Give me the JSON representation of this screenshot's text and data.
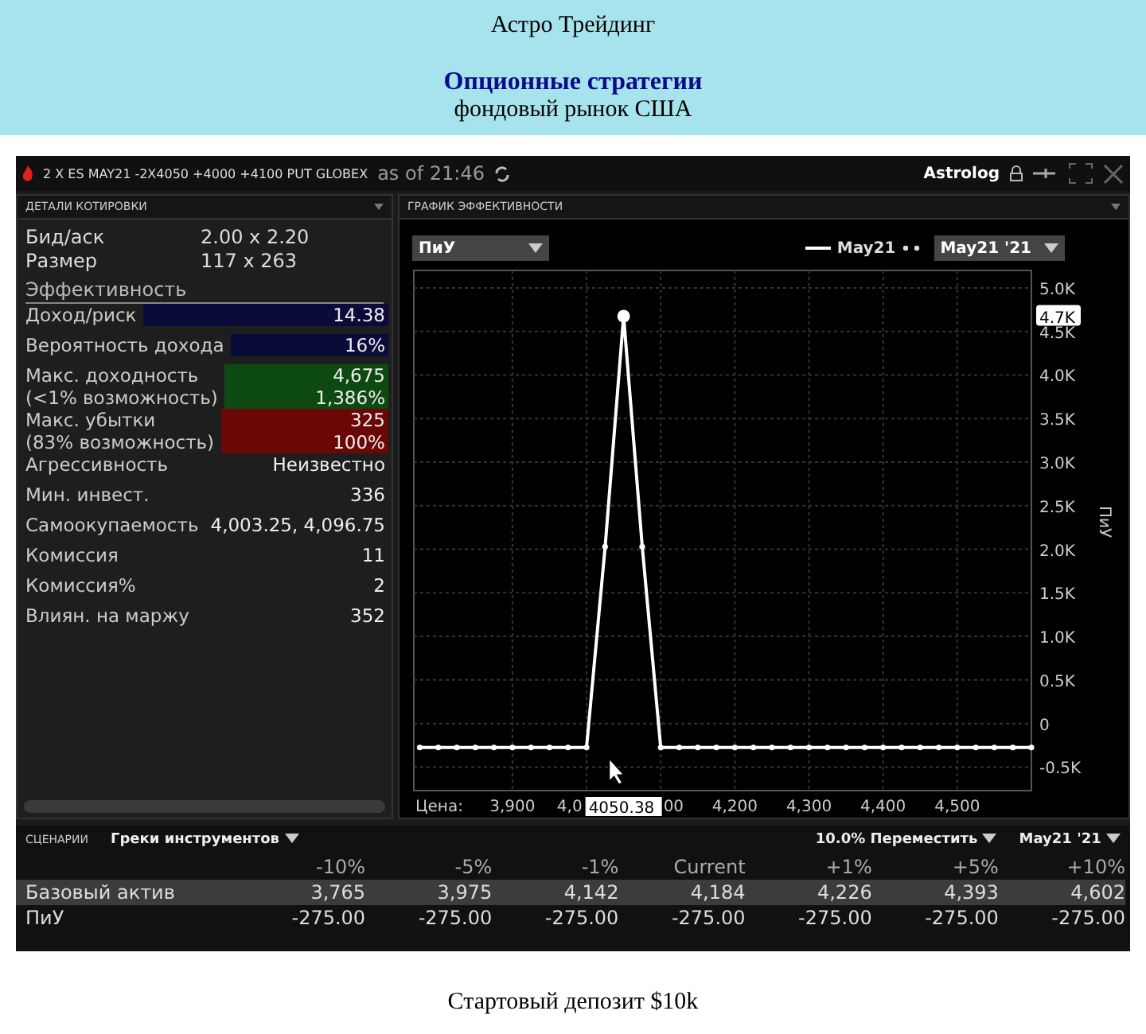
{
  "header": {
    "title": "Астро Трейдинг",
    "subtitle": "Опционные стратегии",
    "caption": "фондовый рынок США"
  },
  "app": {
    "instrument": "2 X ES MAY21  -2X4050  +4000  +4100 PUT GLOBEX",
    "as_of": "as of 21:46",
    "account": "Astrolog"
  },
  "quote_panel": {
    "title": "ДЕТАЛИ КОТИРОВКИ",
    "rows": [
      {
        "label": "Бид/аск",
        "value": "2.00 x 2.20"
      },
      {
        "label": "Размер",
        "value": "117 x 263"
      }
    ],
    "section": "Эффективность",
    "metrics": [
      {
        "labels": [
          "Доход/риск"
        ],
        "values": [
          "14.38"
        ],
        "color": "#0b0b3a"
      },
      {
        "labels": [
          "Вероятность дохода"
        ],
        "values": [
          "16%"
        ],
        "color": "#0b0b3a"
      },
      {
        "labels": [
          "Макс. доходность",
          "(<1% возможность)"
        ],
        "values": [
          "4,675",
          "1,386%"
        ],
        "color": "#0d4a12"
      },
      {
        "labels": [
          "Макс. убытки",
          "(83% возможность)"
        ],
        "values": [
          "325",
          "100%"
        ],
        "color": "#6b0707"
      },
      {
        "labels": [
          "Агрессивность"
        ],
        "values": [
          "Неизвестно"
        ]
      },
      {
        "labels": [
          "Мин. инвест."
        ],
        "values": [
          "336"
        ]
      },
      {
        "labels": [
          "Самоокупаемость"
        ],
        "values": [
          "4,003.25, 4,096.75"
        ]
      },
      {
        "labels": [
          "Комиссия"
        ],
        "values": [
          "11"
        ]
      },
      {
        "labels": [
          "Комиссия%"
        ],
        "values": [
          "2"
        ]
      },
      {
        "labels": [
          "Влиян. на маржу"
        ],
        "values": [
          "352"
        ]
      }
    ]
  },
  "chart_panel": {
    "title": "ГРАФИК ЭФФЕКТИВНОСТИ",
    "metric_dropdown": "ПиУ",
    "date_dropdown": "May21 '21",
    "covered_tick_labels": [
      "4,0",
      "00"
    ],
    "chart_data": {
      "type": "line",
      "xlabel": "Цена:",
      "ylabel": "ПиУ",
      "grid": true,
      "x": [
        3775,
        3800,
        3825,
        3850,
        3875,
        3900,
        3925,
        3950,
        3975,
        4000,
        4025,
        4050,
        4075,
        4100,
        4125,
        4150,
        4175,
        4200,
        4225,
        4250,
        4275,
        4300,
        4325,
        4350,
        4375,
        4400,
        4425,
        4450,
        4475,
        4500,
        4525,
        4550,
        4575,
        4600
      ],
      "series": [
        {
          "name": "May21",
          "color": "#ffffff",
          "marker": "o",
          "values": [
            -275,
            -275,
            -275,
            -275,
            -275,
            -275,
            -275,
            -275,
            -275,
            -275,
            2030,
            4675,
            2030,
            -275,
            -275,
            -275,
            -275,
            -275,
            -275,
            -275,
            -275,
            -275,
            -275,
            -275,
            -275,
            -275,
            -275,
            -275,
            -275,
            -275,
            -275,
            -275,
            -275,
            -275
          ]
        }
      ],
      "xlim": [
        3767,
        4600
      ],
      "ylim": [
        -770,
        5200
      ],
      "xticks": [
        {
          "value": 3900,
          "label": "3,900"
        },
        {
          "value": 4200,
          "label": "4,200"
        },
        {
          "value": 4300,
          "label": "4,300"
        },
        {
          "value": 4400,
          "label": "4,400"
        },
        {
          "value": 4500,
          "label": "4,500"
        }
      ],
      "yticks": [
        {
          "value": -500,
          "label": "-0.5K"
        },
        {
          "value": 0,
          "label": "0"
        },
        {
          "value": 500,
          "label": "0.5K"
        },
        {
          "value": 1000,
          "label": "1.0K"
        },
        {
          "value": 1500,
          "label": "1.5K"
        },
        {
          "value": 2000,
          "label": "2.0K"
        },
        {
          "value": 2500,
          "label": "2.5K"
        },
        {
          "value": 3000,
          "label": "3.0K"
        },
        {
          "value": 3500,
          "label": "3.5K"
        },
        {
          "value": 4000,
          "label": "4.0K"
        },
        {
          "value": 4500,
          "label": "4.5K"
        },
        {
          "value": 5000,
          "label": "5.0K"
        }
      ],
      "annotations": [
        "4.7K",
        "4050.38"
      ]
    }
  },
  "scenarios": {
    "title": "СЦЕНАРИИ",
    "view_dropdown": "Греки инструментов",
    "shift_dropdown": "10.0% Переместить",
    "date_dropdown": "May21 '21",
    "columns": [
      "-10%",
      "-5%",
      "-1%",
      "Current",
      "+1%",
      "+5%",
      "+10%"
    ],
    "rows": [
      {
        "label": "Базовый актив",
        "selected": true,
        "cells": [
          "3,765",
          "3,975",
          "4,142",
          "4,184",
          "4,226",
          "4,393",
          "4,602"
        ]
      },
      {
        "label": "ПиУ",
        "selected": false,
        "cells": [
          "-275.00",
          "-275.00",
          "-275.00",
          "-275.00",
          "-275.00",
          "-275.00",
          "-275.00"
        ]
      }
    ]
  },
  "footer": "Стартовый депозит $10k"
}
